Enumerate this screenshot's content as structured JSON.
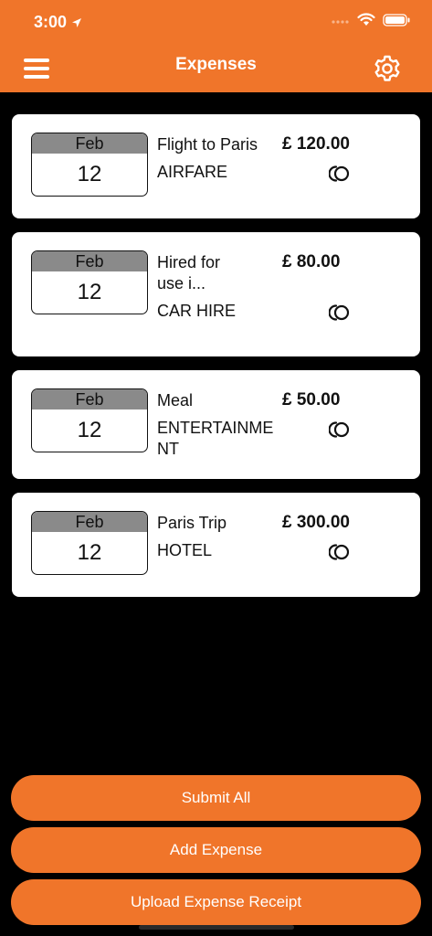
{
  "status_bar": {
    "time": "3:00"
  },
  "nav": {
    "title": "Expenses"
  },
  "expenses": [
    {
      "month": "Feb",
      "day": "12",
      "title": "Flight to Paris",
      "category": "AIRFARE",
      "amount": "£ 120.00"
    },
    {
      "month": "Feb",
      "day": "12",
      "title": "Hired for use i...",
      "category": "CAR HIRE",
      "amount": "£ 80.00"
    },
    {
      "month": "Feb",
      "day": "12",
      "title": "Meal",
      "category": "ENTERTAINMENT",
      "amount": "£ 50.00"
    },
    {
      "month": "Feb",
      "day": "12",
      "title": "Paris Trip",
      "category": "HOTEL",
      "amount": "£ 300.00"
    }
  ],
  "buttons": {
    "submit_all": "Submit All",
    "add_expense": "Add Expense",
    "upload_receipt": "Upload Expense Receipt"
  },
  "colors": {
    "accent": "#f0752a",
    "background": "#000000",
    "card": "#ffffff",
    "calendar_header": "#8a8a8a"
  }
}
